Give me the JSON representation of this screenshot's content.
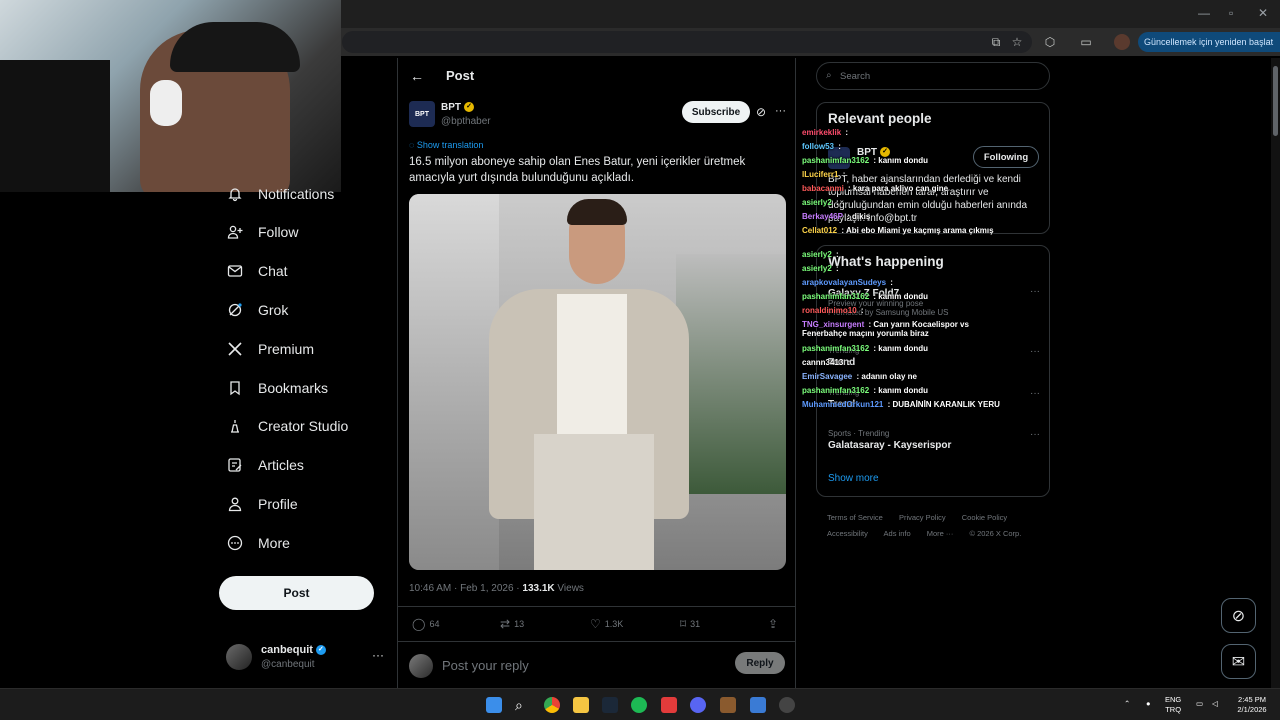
{
  "browser": {
    "update_label": "Güncellemek için yeniden başlat",
    "menu_dots": "⋮"
  },
  "nav": {
    "items": [
      {
        "label": "Notifications",
        "icon": "bell-icon"
      },
      {
        "label": "Follow",
        "icon": "person-plus-icon"
      },
      {
        "label": "Chat",
        "icon": "mail-icon"
      },
      {
        "label": "Grok",
        "icon": "grok-icon"
      },
      {
        "label": "Premium",
        "icon": "x-logo-icon"
      },
      {
        "label": "Bookmarks",
        "icon": "bookmark-icon"
      },
      {
        "label": "Creator Studio",
        "icon": "creator-studio-icon"
      },
      {
        "label": "Articles",
        "icon": "articles-icon"
      },
      {
        "label": "Profile",
        "icon": "person-icon"
      },
      {
        "label": "More",
        "icon": "more-circle-icon"
      }
    ],
    "post_label": "Post",
    "account": {
      "name": "canbequit",
      "handle": "@canbequit",
      "more": "···"
    }
  },
  "post": {
    "header_title": "Post",
    "author": {
      "name": "BPT",
      "handle": "@bpthaber",
      "avatar_text": "BPT"
    },
    "subscribe_label": "Subscribe",
    "show_translation": "Show translation",
    "text": "16.5 milyon aboneye sahip olan Enes Batur, yeni içerikler üretmek amacıyla yurt dışında bulunduğunu açıkladı.",
    "timestamp": "10:46 AM · Feb 1, 2026 · ",
    "views_count": "133.1K",
    "views_label": " Views",
    "stats": {
      "replies": "64",
      "reposts": "13",
      "likes": "1.3K",
      "bookmarks": "31"
    },
    "reply_placeholder": "Post your reply",
    "reply_button": "Reply"
  },
  "sidebar": {
    "search_placeholder": "Search",
    "relevant_title": "Relevant people",
    "relevant_person": {
      "name": "BPT",
      "following_label": "Following",
      "bio": "BPT, haber ajanslarından derlediği ve kendi toplumsal haberleri tarar, araştırır ve doğruluğundan emin olduğu haberleri anında paylaşır. info@bpt.tr"
    },
    "happening_title": "What's happening",
    "trends": [
      {
        "category": "Promoted by Samsung Mobile US",
        "title": "Galaxy Z Fold7",
        "extra": "Preview your winning pose"
      },
      {
        "category": "Trending",
        "title": "Trend"
      },
      {
        "category": "Trending",
        "title": "Trend"
      },
      {
        "category": "Sports · Trending",
        "title": "Galatasaray - Kayserispor"
      }
    ],
    "show_more": "Show more",
    "footer": [
      "Terms of Service",
      "Privacy Policy",
      "Cookie Policy",
      "Accessibility",
      "Ads info",
      "More ···",
      "© 2026 X Corp."
    ]
  },
  "chat": [
    {
      "user": "emirkeklik",
      "text": "",
      "color": "#ff4d6d"
    },
    {
      "user": "follow53",
      "text": "",
      "color": "#5ec8ff"
    },
    {
      "user": "pashanimfan3162",
      "text": "kanım dondu",
      "color": "#7cff7c"
    },
    {
      "user": "lLuciferr1",
      "text": "",
      "color": "#ffd54a"
    },
    {
      "user": "babacanmi",
      "text": "kara para akliyo can gine",
      "color": "#ff5a5a"
    },
    {
      "user": "asierly2",
      "text": "",
      "color": "#7cff7c"
    },
    {
      "user": "Berkay46P",
      "text": "dikiş",
      "color": "#c77dff"
    },
    {
      "user": "Cellat012",
      "text": "Abi ebo Miami ye kaçmış arama çıkmış",
      "color": "#ffd54a"
    },
    {
      "user": "asierly2",
      "text": "",
      "color": "#7cff7c"
    },
    {
      "user": "asierly2",
      "text": "",
      "color": "#7cff7c"
    },
    {
      "user": "arapkovalayanSudeys",
      "text": "",
      "color": "#5e9bff"
    },
    {
      "user": "pashanimfan3162",
      "text": "kanım dondu",
      "color": "#7cff7c"
    },
    {
      "user": "ronaldinimo10",
      "text": "",
      "color": "#ff5a5a"
    },
    {
      "user": "TNG_xinsurgent",
      "text": "Can yarın Kocaelispor vs Fenerbahçe maçını yorumla biraz",
      "color": "#c77dff"
    },
    {
      "user": "pashanimfan3162",
      "text": "kanım dondu",
      "color": "#7cff7c"
    },
    {
      "user": "cannn3413",
      "text": "",
      "color": "#ffffff"
    },
    {
      "user": "EmirSavagee",
      "text": "adanın olay ne",
      "color": "#8ab4ff"
    },
    {
      "user": "pashanimfan3162",
      "text": "kanım dondu",
      "color": "#7cff7c"
    },
    {
      "user": "MuhammedOrkun121",
      "text": "DUBAİNİN KARANLIK YERU",
      "color": "#5e9bff"
    }
  ],
  "taskbar": {
    "lang": "ENG",
    "layout": "TRQ",
    "time": "2:45 PM",
    "date": "2/1/2026"
  }
}
